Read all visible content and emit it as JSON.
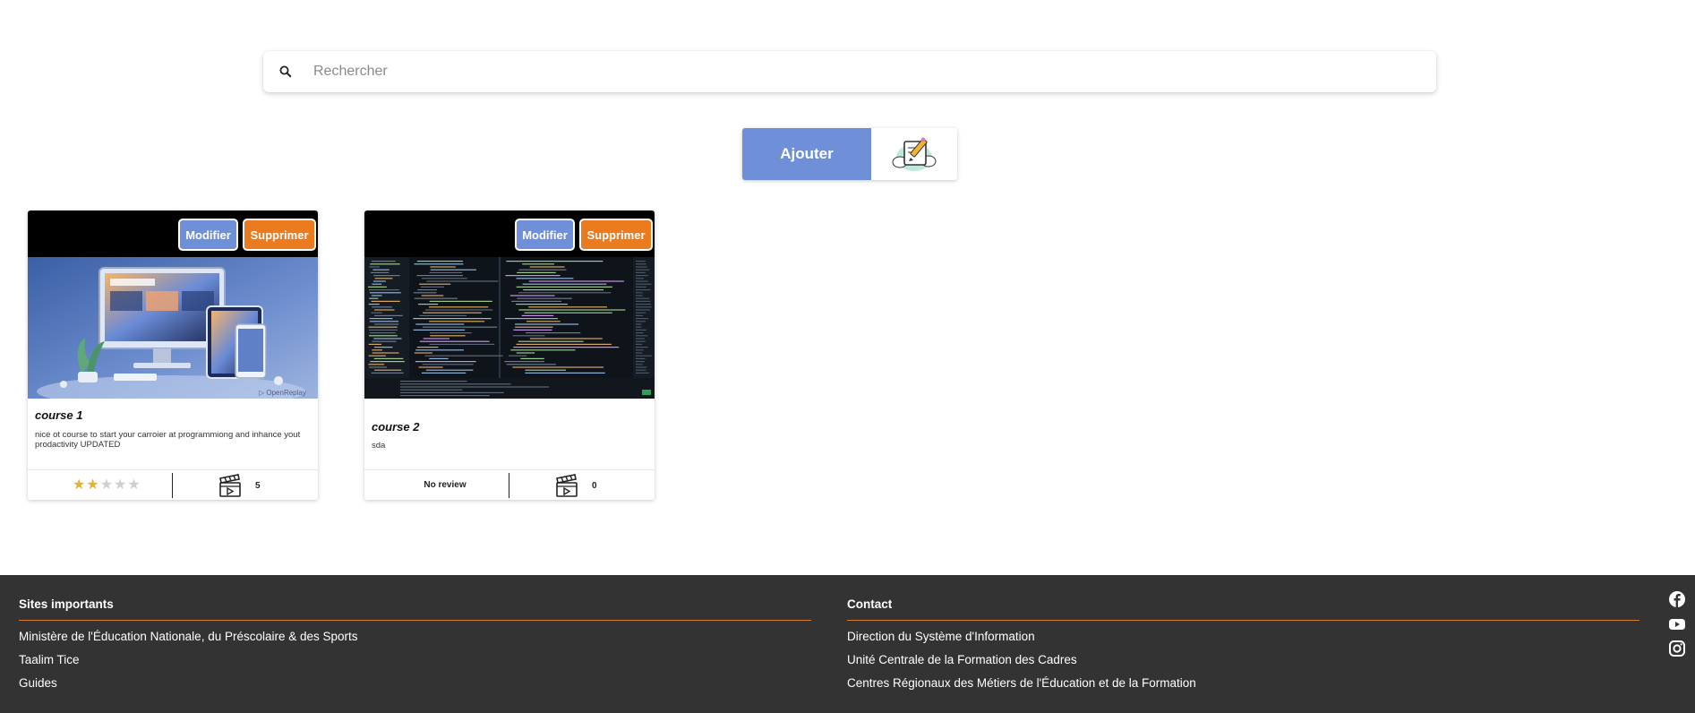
{
  "search": {
    "placeholder": "Rechercher",
    "icon": "search-icon"
  },
  "actions": {
    "add_label": "Ajouter",
    "illustration_icon": "edit-note-illustration"
  },
  "courses": [
    {
      "title": "course 1",
      "description": "nice ot course to start your carroier at programmiong and inhance yout prodactivity UPDATED",
      "edit_label": "Modifier",
      "delete_label": "Supprimer",
      "rating": 2,
      "rating_max": 5,
      "video_count": "5",
      "thumbnail": "responsive-devices-image",
      "watermark": "OpenReplay"
    },
    {
      "title": "course 2",
      "description": "sda",
      "edit_label": "Modifier",
      "delete_label": "Supprimer",
      "review_text": "No review",
      "video_count": "0",
      "thumbnail": "code-editor-screenshot"
    }
  ],
  "footer": {
    "sites": {
      "heading": "Sites importants",
      "links": [
        "Ministère de l'Éducation Nationale, du Préscolaire & des Sports",
        "Taalim Tice",
        "Guides"
      ]
    },
    "contact": {
      "heading": "Contact",
      "links": [
        "Direction du Système d'Information",
        "Unité Centrale de la Formation des Cadres",
        "Centres Régionaux des Métiers de l'Éducation et de la Formation"
      ]
    },
    "social": [
      "facebook-icon",
      "youtube-icon",
      "instagram-icon"
    ]
  },
  "colors": {
    "primary": "#6f8fd9",
    "danger": "#ec7a1f",
    "footer_bg": "#333333",
    "footer_rule": "#d27a30",
    "star": "#e2b331"
  }
}
